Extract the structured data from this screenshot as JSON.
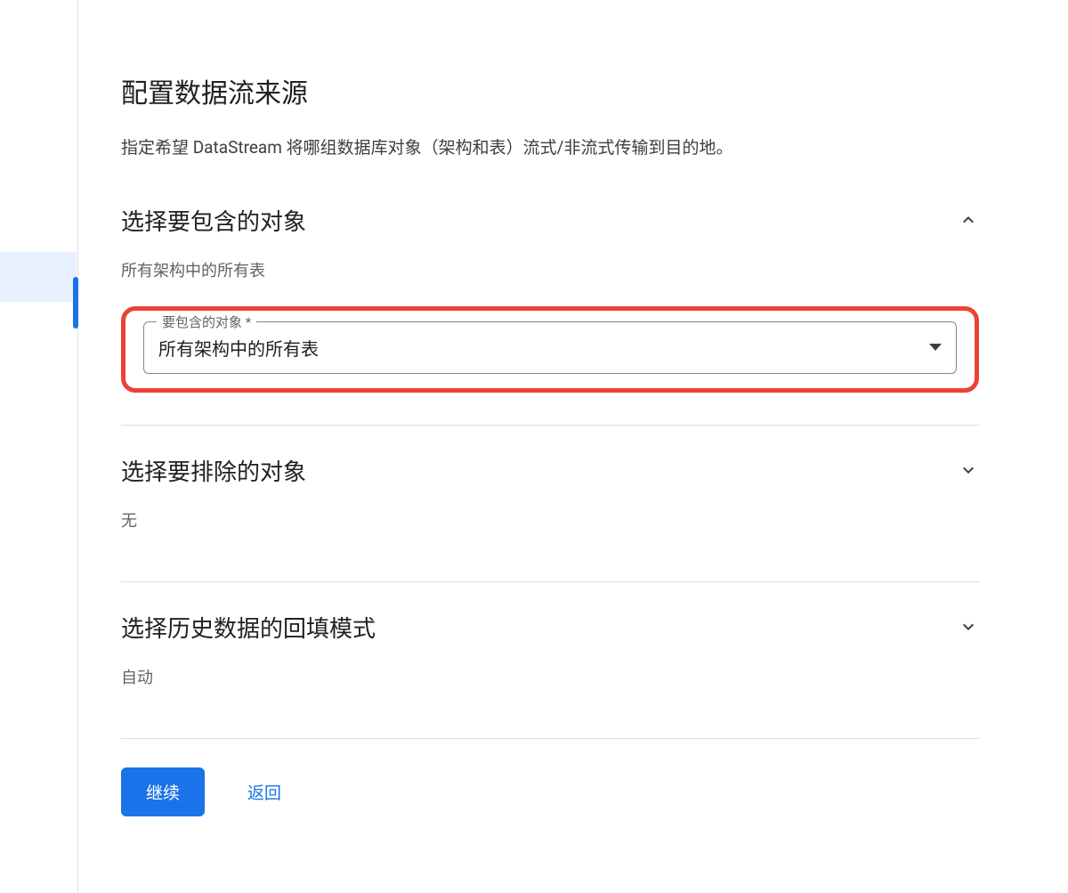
{
  "page": {
    "title": "配置数据流来源",
    "description": "指定希望 DataStream 将哪组数据库对象（架构和表）流式/非流式传输到目的地。"
  },
  "sections": {
    "include": {
      "title": "选择要包含的对象",
      "subtitle": "所有架构中的所有表",
      "expanded": true,
      "select": {
        "label": "要包含的对象 *",
        "value": "所有架构中的所有表"
      }
    },
    "exclude": {
      "title": "选择要排除的对象",
      "subtitle": "无",
      "expanded": false
    },
    "backfill": {
      "title": "选择历史数据的回填模式",
      "subtitle": "自动",
      "expanded": false
    }
  },
  "buttons": {
    "continue": "继续",
    "back": "返回"
  }
}
